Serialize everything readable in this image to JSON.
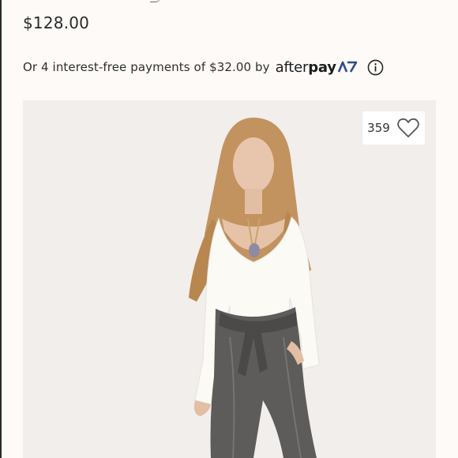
{
  "product": {
    "price": "$128.00"
  },
  "afterpay": {
    "message": "Or 4 interest-free payments of $32.00 by",
    "logo_text_light": "after",
    "logo_text_bold": "pay",
    "brand_color": "#2b4f8a",
    "info_icon": "info-circle-icon"
  },
  "product_image": {
    "likes_count": "359",
    "like_icon": "heart-outline-icon"
  },
  "colors": {
    "page_background": "#fdfaf7",
    "image_background": "#f1eeeb",
    "text": "#2a2a2a"
  }
}
